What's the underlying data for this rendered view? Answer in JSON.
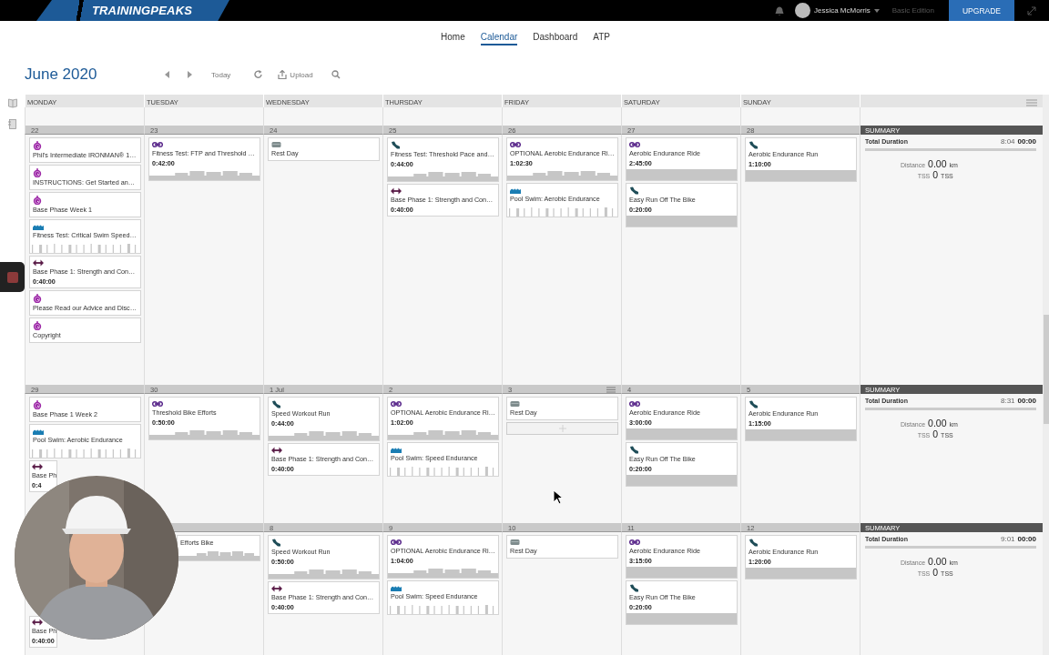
{
  "topbar": {
    "logo": "TRAININGPEAKS",
    "user": "Jessica McMorris",
    "edition": "Basic Edition",
    "upgrade": "UPGRADE"
  },
  "nav": [
    {
      "label": "Home",
      "selected": false
    },
    {
      "label": "Calendar",
      "selected": true
    },
    {
      "label": "Dashboard",
      "selected": false
    },
    {
      "label": "ATP",
      "selected": false
    }
  ],
  "toolbar": {
    "month": "June",
    "year": "2020",
    "today": "Today",
    "upload": "Upload"
  },
  "weekdays": [
    "MONDAY",
    "TUESDAY",
    "WEDNESDAY",
    "THURSDAY",
    "FRIDAY",
    "SATURDAY",
    "SUNDAY"
  ],
  "weeks": [
    {
      "days": [
        {
          "date": "22",
          "workouts": [
            {
              "kind": "plan",
              "title": "Phil's Intermediate IRONMAN® 1…"
            },
            {
              "kind": "plan",
              "title": "INSTRUCTIONS: Get Started an…"
            },
            {
              "kind": "plan",
              "title": "Base Phase Week 1"
            },
            {
              "kind": "swim",
              "title": "Fitness Test: Critical Swim Speed…",
              "graph": {
                "kind": "ticks"
              }
            },
            {
              "kind": "strength",
              "title": "Base Phase 1: Strength and Con…",
              "duration": "0:40:00"
            },
            {
              "kind": "plan",
              "title": "Please Read our Advice and Disc…"
            },
            {
              "kind": "plan",
              "title": "Copyright"
            }
          ]
        },
        {
          "date": "23",
          "workouts": [
            {
              "kind": "bike",
              "title": "Fitness Test: FTP and Threshold …",
              "duration": "0:42:00",
              "graph": {
                "kind": "steps"
              }
            }
          ]
        },
        {
          "date": "24",
          "workouts": [
            {
              "kind": "rest",
              "title": "Rest Day"
            }
          ]
        },
        {
          "date": "25",
          "workouts": [
            {
              "kind": "run",
              "title": "Fitness Test: Threshold Pace and…",
              "duration": "0:44:00",
              "graph": {
                "kind": "steps"
              }
            },
            {
              "kind": "strength",
              "title": "Base Phase 1: Strength and Con…",
              "duration": "0:40:00"
            }
          ]
        },
        {
          "date": "26",
          "workouts": [
            {
              "kind": "bike",
              "title": "OPTIONAL Aerobic Endurance Ri…",
              "duration": "1:02:30",
              "graph": {
                "kind": "steps"
              }
            },
            {
              "kind": "swim",
              "title": "Pool Swim: Aerobic Endurance",
              "graph": {
                "kind": "ticks"
              }
            }
          ]
        },
        {
          "date": "27",
          "workouts": [
            {
              "kind": "bike",
              "title": "Aerobic Endurance Ride",
              "duration": "2:45:00",
              "graph": {
                "kind": "flat"
              }
            },
            {
              "kind": "run",
              "title": "Easy Run Off The Bike",
              "duration": "0:20:00",
              "graph": {
                "kind": "flat"
              }
            }
          ]
        },
        {
          "date": "28",
          "workouts": [
            {
              "kind": "run",
              "title": "Aerobic Endurance Run",
              "duration": "1:10:00",
              "graph": {
                "kind": "flat"
              }
            }
          ]
        }
      ],
      "summary": {
        "heading": "SUMMARY",
        "duration_label": "Total Duration",
        "planned": "8:04",
        "completed": "00:00",
        "distance_label": "Distance",
        "distance": "0.00",
        "distance_unit": "km",
        "tss_label": "TSS",
        "tss": "0",
        "tss_unit": "TSS"
      }
    },
    {
      "days": [
        {
          "date": "29",
          "workouts": [
            {
              "kind": "plan",
              "title": "Base Phase 1 Week 2"
            },
            {
              "kind": "swim",
              "title": "Pool Swim: Aerobic Endurance",
              "graph": {
                "kind": "ticks"
              }
            },
            {
              "kind": "strength",
              "title": "Base Ph",
              "duration": "0:4",
              "covered_right": true
            }
          ]
        },
        {
          "date": "30",
          "workouts": [
            {
              "kind": "bike",
              "title": "Threshold Bike Efforts",
              "duration": "0:50:00",
              "graph": {
                "kind": "steps"
              }
            }
          ]
        },
        {
          "date": "1 Jul",
          "workouts": [
            {
              "kind": "run",
              "title": "Speed Workout Run",
              "duration": "0:44:00",
              "graph": {
                "kind": "steps"
              }
            },
            {
              "kind": "strength",
              "title": "Base Phase 1: Strength and Con…",
              "duration": "0:40:00"
            }
          ]
        },
        {
          "date": "2",
          "workouts": [
            {
              "kind": "bike",
              "title": "OPTIONAL Aerobic Endurance Ri…",
              "duration": "1:02:00",
              "graph": {
                "kind": "steps"
              }
            },
            {
              "kind": "swim",
              "title": "Pool Swim: Speed Endurance",
              "graph": {
                "kind": "ticks"
              }
            }
          ]
        },
        {
          "date": "3",
          "hovered": true,
          "workouts": [
            {
              "kind": "rest",
              "title": "Rest Day"
            }
          ]
        },
        {
          "date": "4",
          "workouts": [
            {
              "kind": "bike",
              "title": "Aerobic Endurance Ride",
              "duration": "3:00:00",
              "graph": {
                "kind": "flat"
              }
            },
            {
              "kind": "run",
              "title": "Easy Run Off The Bike",
              "duration": "0:20:00",
              "graph": {
                "kind": "flat"
              }
            }
          ]
        },
        {
          "date": "5",
          "workouts": [
            {
              "kind": "run",
              "title": "Aerobic Endurance Run",
              "duration": "1:15:00",
              "graph": {
                "kind": "flat"
              }
            }
          ]
        }
      ],
      "summary": {
        "heading": "SUMMARY",
        "duration_label": "Total Duration",
        "planned": "8:31",
        "completed": "00:00",
        "distance_label": "Distance",
        "distance": "0.00",
        "distance_unit": "km",
        "tss_label": "TSS",
        "tss": "0",
        "tss_unit": "TSS"
      }
    },
    {
      "days": [
        {
          "covered_top": true,
          "workouts": [
            {
              "kind": "strength",
              "title": "Base Ph",
              "duration": "0:40:00",
              "covered_right": true
            }
          ]
        },
        {
          "workouts": [
            {
              "covered_left": true,
              "title": "Efforts Bike",
              "graph": {
                "kind": "steps"
              }
            }
          ]
        },
        {
          "date": "8",
          "workouts": [
            {
              "kind": "run",
              "title": "Speed Workout Run",
              "duration": "0:50:00",
              "graph": {
                "kind": "steps"
              }
            },
            {
              "kind": "strength",
              "title": "Base Phase 1: Strength and Con…",
              "duration": "0:40:00"
            }
          ]
        },
        {
          "date": "9",
          "workouts": [
            {
              "kind": "bike",
              "title": "OPTIONAL Aerobic Endurance Ri…",
              "duration": "1:04:00",
              "graph": {
                "kind": "steps"
              }
            },
            {
              "kind": "swim",
              "title": "Pool Swim: Speed Endurance",
              "graph": {
                "kind": "ticks"
              }
            }
          ]
        },
        {
          "date": "10",
          "workouts": [
            {
              "kind": "rest",
              "title": "Rest Day"
            }
          ]
        },
        {
          "date": "11",
          "workouts": [
            {
              "kind": "bike",
              "title": "Aerobic Endurance Ride",
              "duration": "3:15:00",
              "graph": {
                "kind": "flat"
              }
            },
            {
              "kind": "run",
              "title": "Easy Run Off The Bike",
              "duration": "0:20:00",
              "graph": {
                "kind": "flat"
              }
            }
          ]
        },
        {
          "date": "12",
          "workouts": [
            {
              "kind": "run",
              "title": "Aerobic Endurance Run",
              "duration": "1:20:00",
              "graph": {
                "kind": "flat"
              }
            }
          ]
        }
      ],
      "summary": {
        "heading": "SUMMARY",
        "duration_label": "Total Duration",
        "planned": "9:01",
        "completed": "00:00",
        "distance_label": "Distance",
        "distance": "0.00",
        "distance_unit": "km",
        "tss_label": "TSS",
        "tss": "0",
        "tss_unit": "TSS"
      }
    }
  ]
}
